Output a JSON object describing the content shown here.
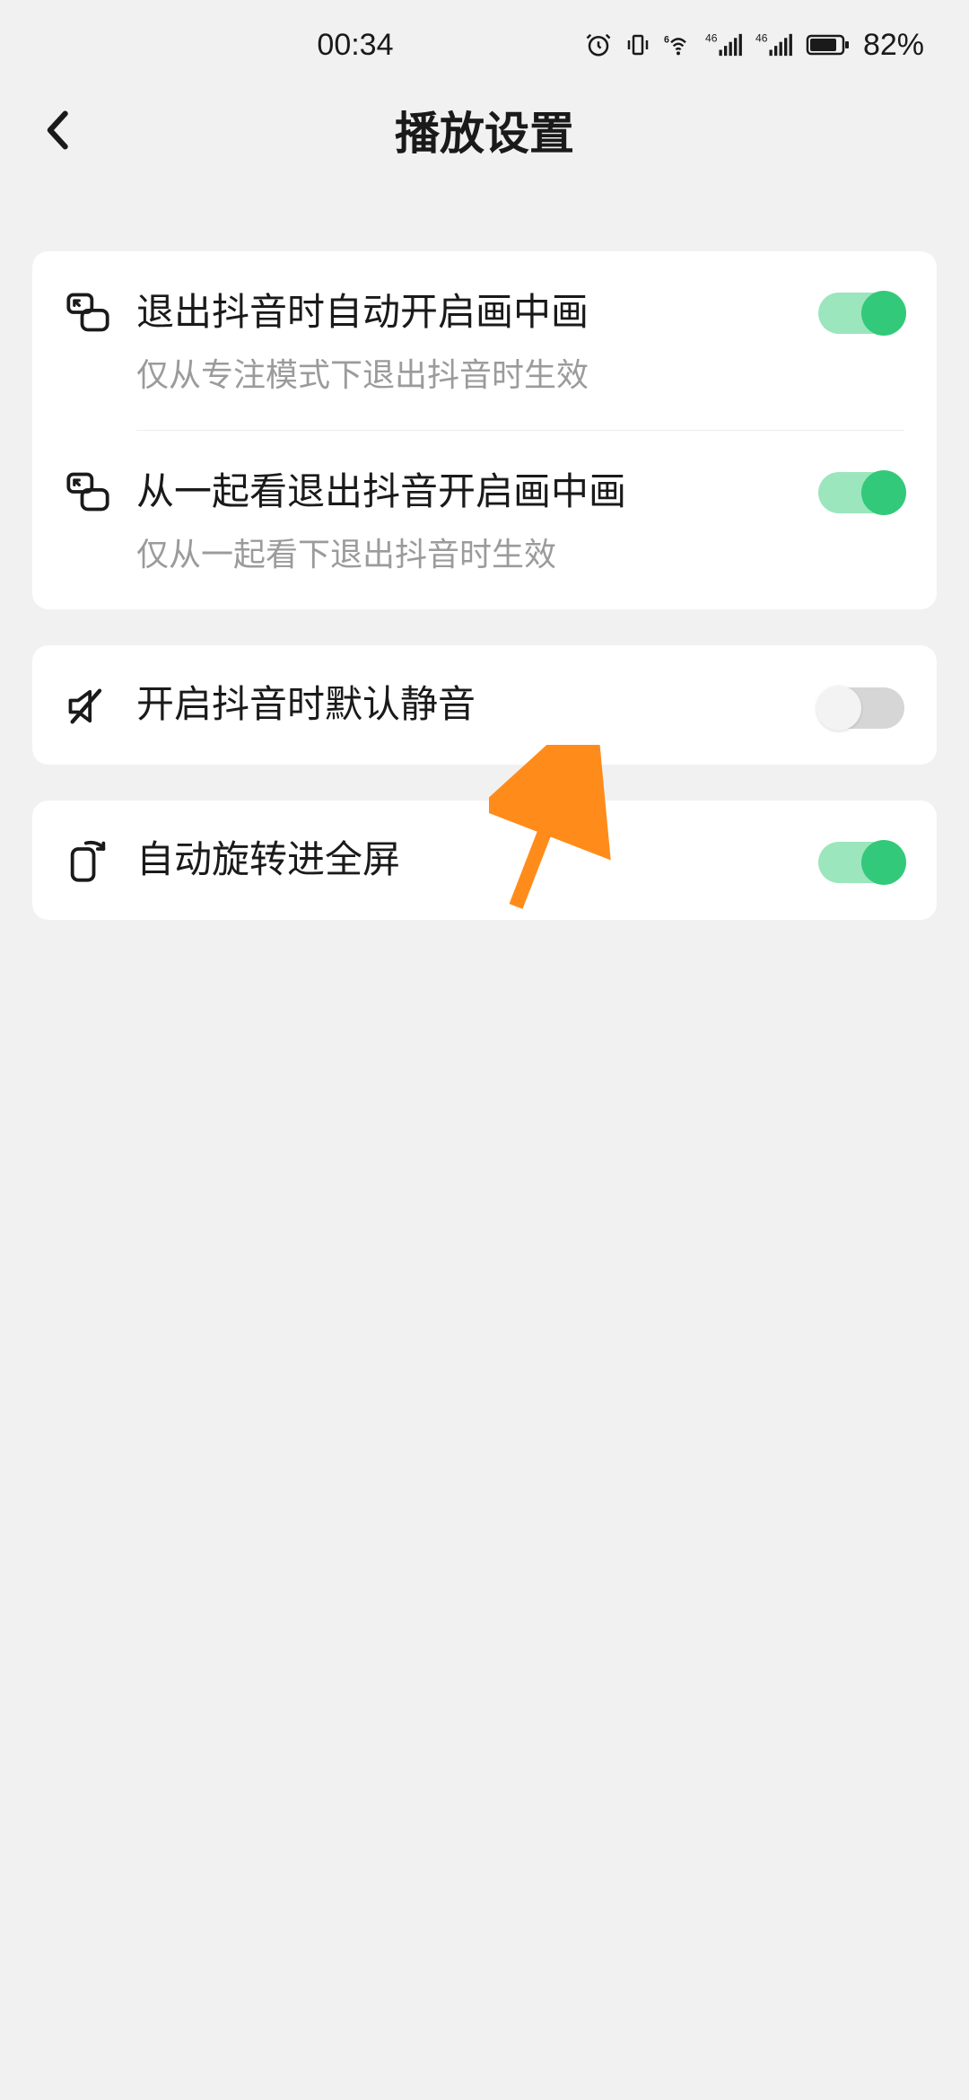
{
  "status_bar": {
    "time": "00:34",
    "battery_percent": "82%"
  },
  "header": {
    "title": "播放设置"
  },
  "settings": {
    "group1": {
      "item1": {
        "title": "退出抖音时自动开启画中画",
        "subtitle": "仅从专注模式下退出抖音时生效",
        "toggle": "on"
      },
      "item2": {
        "title": "从一起看退出抖音开启画中画",
        "subtitle": "仅从一起看下退出抖音时生效",
        "toggle": "on"
      }
    },
    "group2": {
      "item1": {
        "title": "开启抖音时默认静音",
        "toggle": "off"
      }
    },
    "group3": {
      "item1": {
        "title": "自动旋转进全屏",
        "toggle": "on"
      }
    }
  }
}
